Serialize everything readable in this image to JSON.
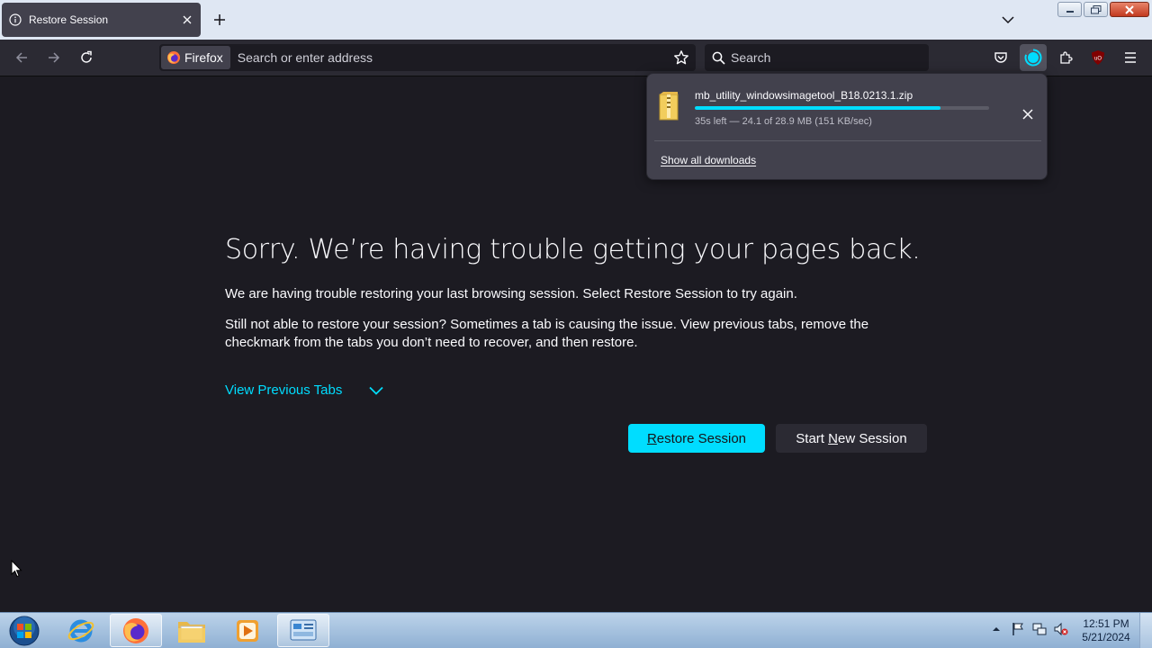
{
  "tab": {
    "title": "Restore Session",
    "icon": "info-icon"
  },
  "navbar": {
    "identity_label": "Firefox",
    "url_placeholder": "Search or enter address",
    "search_placeholder": "Search"
  },
  "downloads": {
    "filename": "mb_utility_windowsimagetool_B18.0213.1.zip",
    "status": "35s left — 24.1 of 28.9 MB (151 KB/sec)",
    "progress_fraction": 0.834,
    "show_all_label": "Show all downloads"
  },
  "content": {
    "title": "Sorry. We’re having trouble getting your pages back.",
    "para1": "We are having trouble restoring your last browsing session. Select Restore Session to try again.",
    "para2": "Still not able to restore your session? Sometimes a tab is causing the issue. View previous tabs, remove the checkmark from the tabs you don’t need to recover, and then restore.",
    "view_tabs_label": "View Previous Tabs",
    "restore_label": {
      "before": "",
      "key": "R",
      "after": "estore Session"
    },
    "new_session_label": {
      "before": "Start ",
      "key": "N",
      "after": "ew Session"
    }
  },
  "taskbar": {
    "apps": [
      "internet-explorer",
      "firefox",
      "file-explorer",
      "media-player",
      "control-panel"
    ],
    "time": "12:51 PM",
    "date": "5/21/2024"
  },
  "colors": {
    "accent": "#00ddff",
    "page_bg": "#1c1b22",
    "toolbar_bg": "#2b2a33",
    "panel_bg": "#42414d"
  }
}
